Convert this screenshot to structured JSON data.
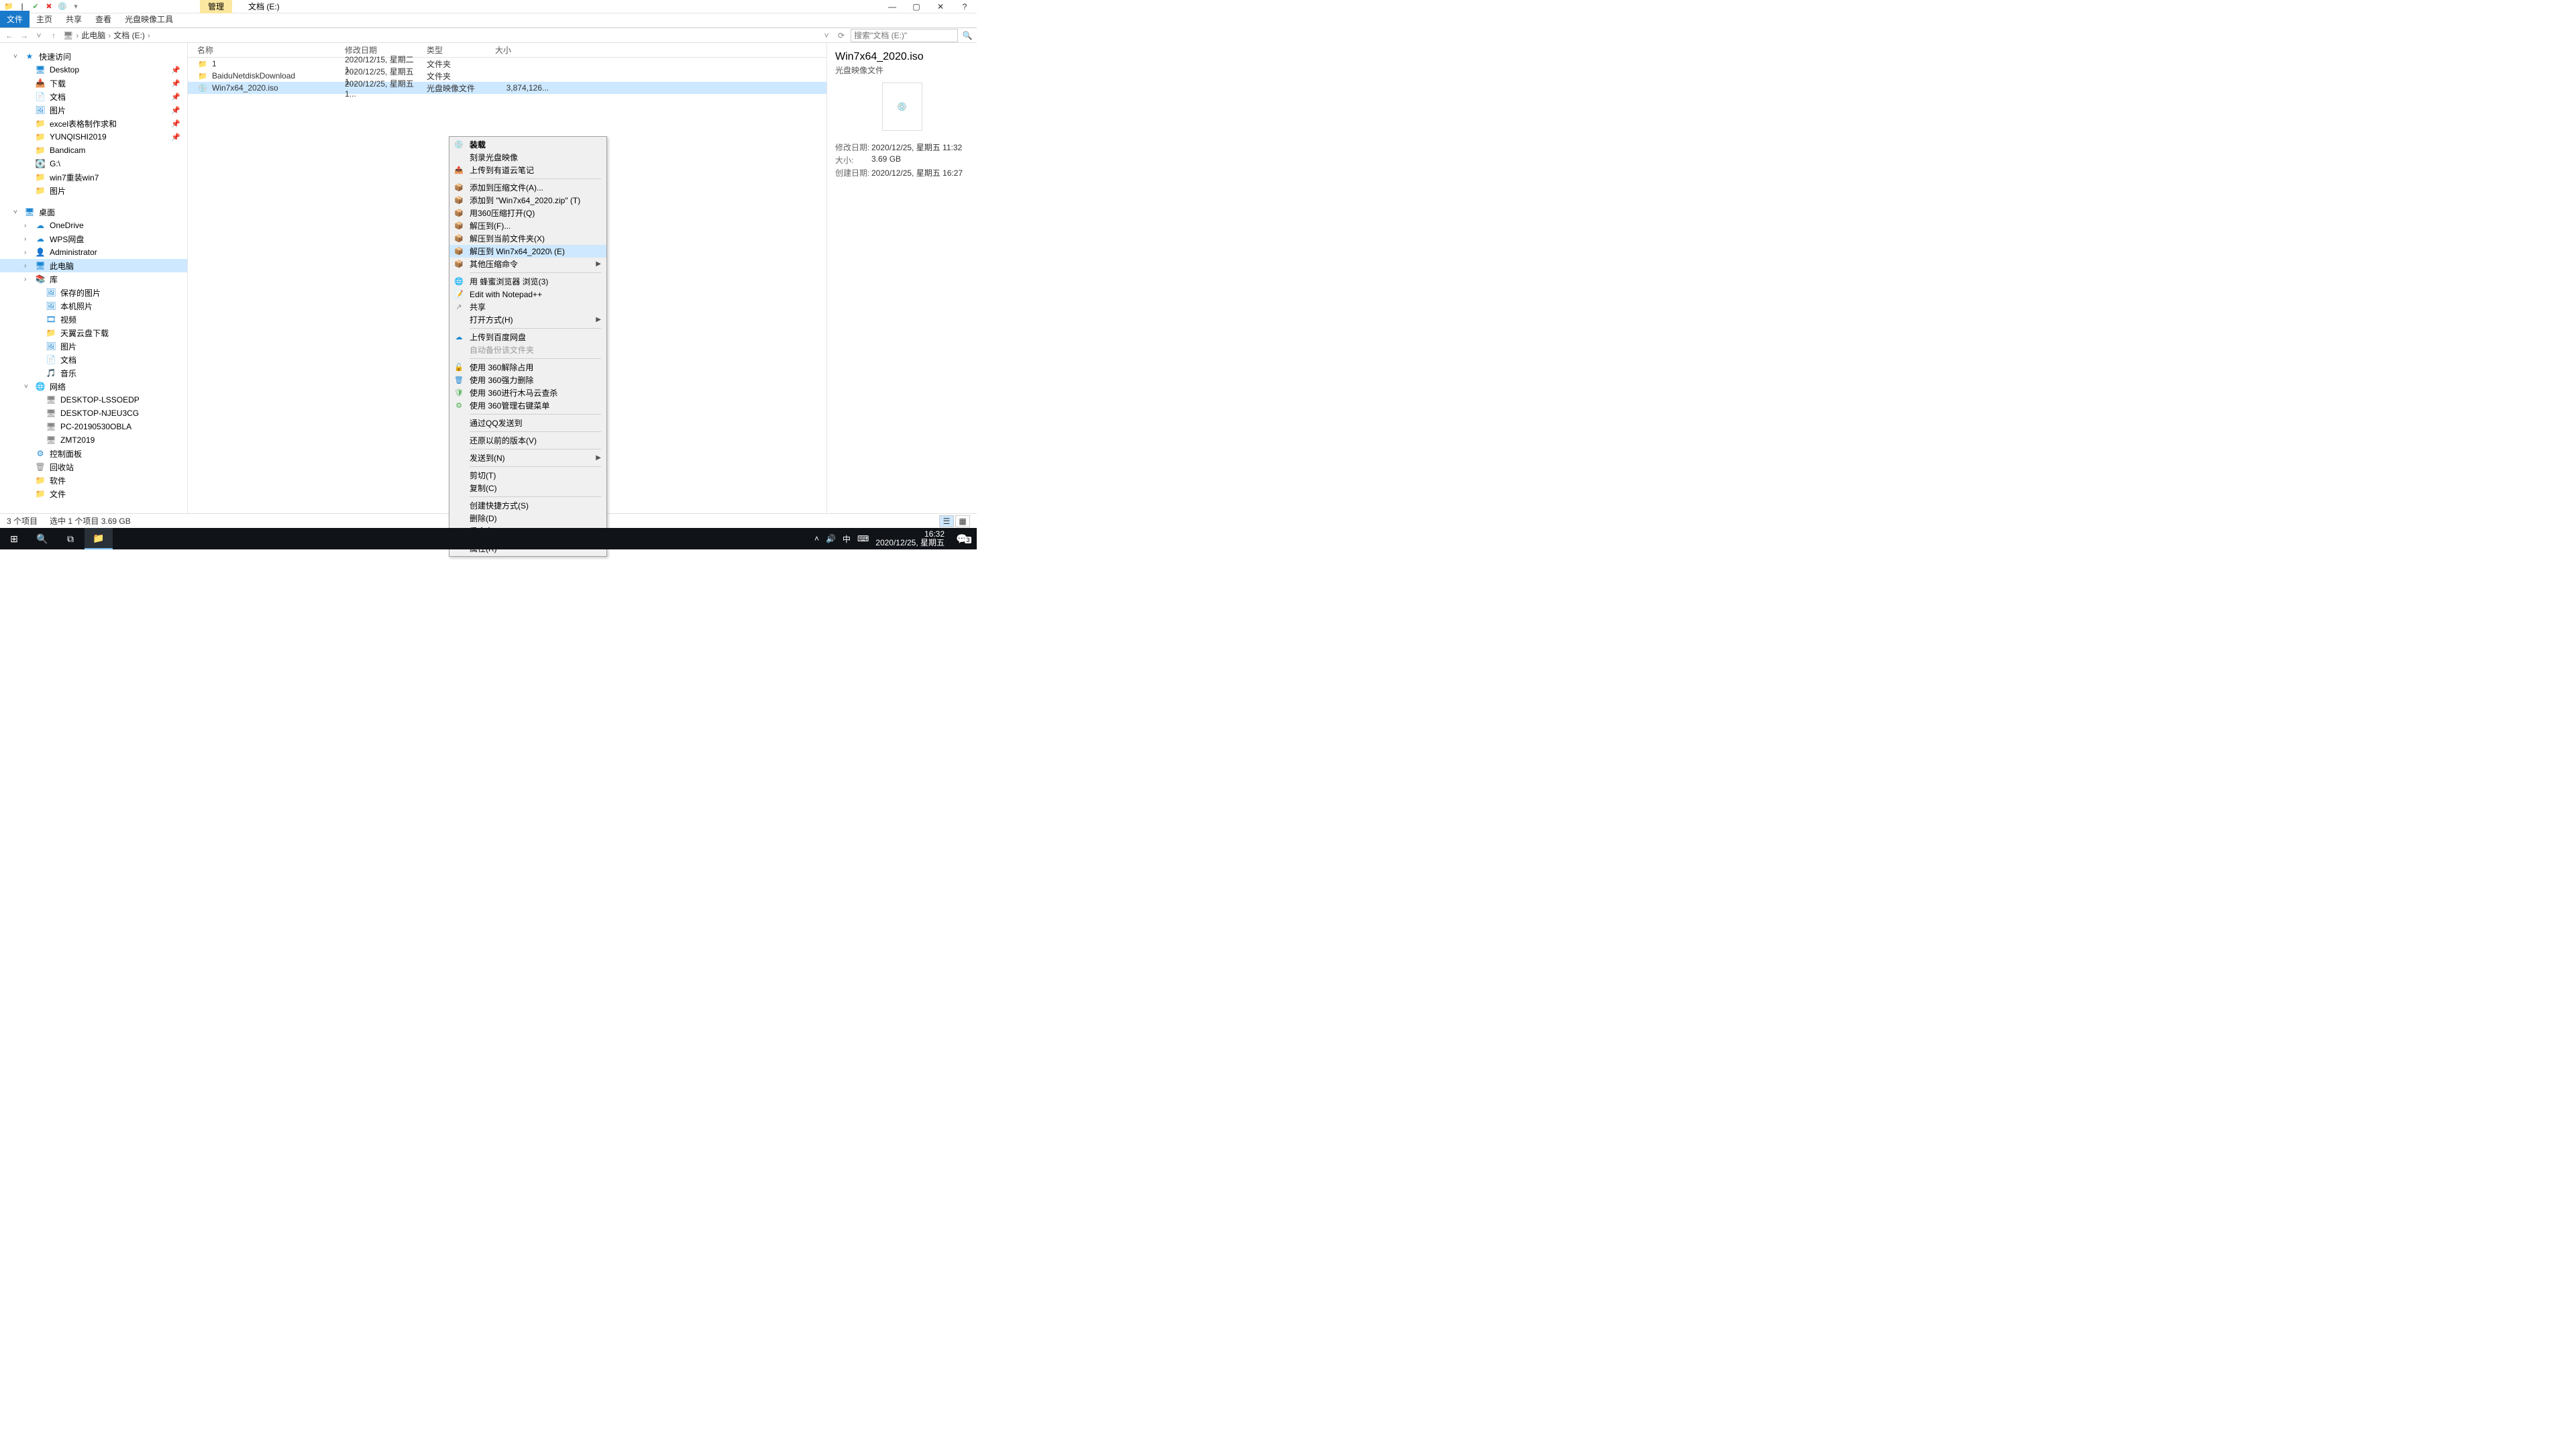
{
  "window": {
    "context_tab": "管理",
    "title": "文档 (E:)",
    "min": "—",
    "max": "▢",
    "close": "✕",
    "help": "?"
  },
  "ribbon": {
    "file": "文件",
    "home": "主页",
    "share": "共享",
    "view": "查看",
    "iso_tools": "光盘映像工具"
  },
  "address": {
    "back": "←",
    "forward": "→",
    "up": "↑",
    "root": "此电脑",
    "folder": "文档 (E:)",
    "sep": "›",
    "refresh": "⟳",
    "dropdown": "˅",
    "search_placeholder": "搜索\"文档 (E:)\"",
    "search_icon": "🔍"
  },
  "tree": {
    "quick": "快速访问",
    "quick_items": [
      {
        "label": "Desktop",
        "icon": "🖥",
        "pinned": true,
        "color": "color-blue"
      },
      {
        "label": "下载",
        "icon": "📥",
        "pinned": true,
        "color": "color-blue"
      },
      {
        "label": "文档",
        "icon": "📄",
        "pinned": true,
        "color": "color-blue"
      },
      {
        "label": "图片",
        "icon": "🖼",
        "pinned": true,
        "color": "color-blue"
      },
      {
        "label": "excel表格制作求和",
        "icon": "📁",
        "pinned": true,
        "color": "color-yellow"
      },
      {
        "label": "YUNQISHI2019",
        "icon": "📁",
        "pinned": true,
        "color": "color-yellow"
      },
      {
        "label": "Bandicam",
        "icon": "📁",
        "pinned": false,
        "color": "color-yellow"
      },
      {
        "label": "G:\\",
        "icon": "💽",
        "pinned": false,
        "color": "color-gray"
      },
      {
        "label": "win7重装win7",
        "icon": "📁",
        "pinned": false,
        "color": "color-yellow"
      },
      {
        "label": "图片",
        "icon": "📁",
        "pinned": false,
        "color": "color-yellow"
      }
    ],
    "desktop": "桌面",
    "desktop_items": [
      {
        "label": "OneDrive",
        "icon": "☁",
        "color": "color-blue"
      },
      {
        "label": "WPS网盘",
        "icon": "☁",
        "color": "color-blue"
      },
      {
        "label": "Administrator",
        "icon": "👤",
        "color": "color-teal"
      },
      {
        "label": "此电脑",
        "icon": "🖥",
        "color": "color-blue",
        "selected": true
      },
      {
        "label": "库",
        "icon": "📚",
        "color": "color-blue"
      }
    ],
    "lib_items": [
      {
        "label": "保存的图片",
        "icon": "🖼",
        "color": "color-blue"
      },
      {
        "label": "本机照片",
        "icon": "🖼",
        "color": "color-blue"
      },
      {
        "label": "视频",
        "icon": "🎞",
        "color": "color-blue"
      },
      {
        "label": "天翼云盘下载",
        "icon": "📁",
        "color": "color-yellow"
      },
      {
        "label": "图片",
        "icon": "🖼",
        "color": "color-blue"
      },
      {
        "label": "文档",
        "icon": "📄",
        "color": "color-blue"
      },
      {
        "label": "音乐",
        "icon": "🎵",
        "color": "color-blue"
      }
    ],
    "network": "网络",
    "network_items": [
      {
        "label": "DESKTOP-LSSOEDP",
        "icon": "🖥",
        "color": "color-gray"
      },
      {
        "label": "DESKTOP-NJEU3CG",
        "icon": "🖥",
        "color": "color-gray"
      },
      {
        "label": "PC-20190530OBLA",
        "icon": "🖥",
        "color": "color-gray"
      },
      {
        "label": "ZMT2019",
        "icon": "🖥",
        "color": "color-gray"
      }
    ],
    "bottom_items": [
      {
        "label": "控制面板",
        "icon": "⚙",
        "color": "color-blue"
      },
      {
        "label": "回收站",
        "icon": "🗑",
        "color": "color-gray"
      },
      {
        "label": "软件",
        "icon": "📁",
        "color": "color-yellow"
      },
      {
        "label": "文件",
        "icon": "📁",
        "color": "color-yellow"
      }
    ]
  },
  "list": {
    "headers": {
      "name": "名称",
      "date": "修改日期",
      "type": "类型",
      "size": "大小"
    },
    "rows": [
      {
        "name": "1",
        "date": "2020/12/15, 星期二 1...",
        "type": "文件夹",
        "size": "",
        "icon": "📁",
        "ico_class": "folder-ico"
      },
      {
        "name": "BaiduNetdiskDownload",
        "date": "2020/12/25, 星期五 1...",
        "type": "文件夹",
        "size": "",
        "icon": "📁",
        "ico_class": "folder-ico"
      },
      {
        "name": "Win7x64_2020.iso",
        "date": "2020/12/25, 星期五 1...",
        "type": "光盘映像文件",
        "size": "3,874,126...",
        "icon": "💿",
        "ico_class": "iso-ico",
        "selected": true
      }
    ]
  },
  "context": [
    {
      "type": "item",
      "label": "装载",
      "bold": true,
      "icon": "💿",
      "color": "color-gray"
    },
    {
      "type": "item",
      "label": "刻录光盘映像",
      "icon": ""
    },
    {
      "type": "item",
      "label": "上传到有道云笔记",
      "icon": "📤",
      "color": "color-blue"
    },
    {
      "type": "sep"
    },
    {
      "type": "item",
      "label": "添加到压缩文件(A)...",
      "icon": "📦",
      "color": "color-orange"
    },
    {
      "type": "item",
      "label": "添加到 \"Win7x64_2020.zip\" (T)",
      "icon": "📦",
      "color": "color-orange"
    },
    {
      "type": "item",
      "label": "用360压缩打开(Q)",
      "icon": "📦",
      "color": "color-orange"
    },
    {
      "type": "item",
      "label": "解压到(F)...",
      "icon": "📦",
      "color": "color-orange"
    },
    {
      "type": "item",
      "label": "解压到当前文件夹(X)",
      "icon": "📦",
      "color": "color-orange"
    },
    {
      "type": "item",
      "label": "解压到 Win7x64_2020\\ (E)",
      "icon": "📦",
      "color": "color-orange",
      "hover": true
    },
    {
      "type": "item",
      "label": "其他压缩命令",
      "icon": "📦",
      "color": "color-orange",
      "sub": true
    },
    {
      "type": "sep"
    },
    {
      "type": "item",
      "label": "用 蜂蜜浏览器 浏览(3)",
      "icon": "🌐",
      "color": "color-green"
    },
    {
      "type": "item",
      "label": "Edit with Notepad++",
      "icon": "📝",
      "color": "color-green"
    },
    {
      "type": "item",
      "label": "共享",
      "icon": "↗",
      "color": "color-gray"
    },
    {
      "type": "item",
      "label": "打开方式(H)",
      "icon": "",
      "sub": true
    },
    {
      "type": "sep"
    },
    {
      "type": "item",
      "label": "上传到百度网盘",
      "icon": "☁",
      "color": "color-blue"
    },
    {
      "type": "item",
      "label": "自动备份该文件夹",
      "icon": "",
      "disabled": true
    },
    {
      "type": "sep"
    },
    {
      "type": "item",
      "label": "使用 360解除占用",
      "icon": "🔓",
      "color": "color-orange"
    },
    {
      "type": "item",
      "label": "使用 360强力删除",
      "icon": "🗑",
      "color": "color-blue"
    },
    {
      "type": "item",
      "label": "使用 360进行木马云查杀",
      "icon": "🛡",
      "color": "color-green"
    },
    {
      "type": "item",
      "label": "使用 360管理右键菜单",
      "icon": "⚙",
      "color": "color-green"
    },
    {
      "type": "sep"
    },
    {
      "type": "item",
      "label": "通过QQ发送到",
      "icon": ""
    },
    {
      "type": "sep"
    },
    {
      "type": "item",
      "label": "还原以前的版本(V)",
      "icon": ""
    },
    {
      "type": "sep"
    },
    {
      "type": "item",
      "label": "发送到(N)",
      "icon": "",
      "sub": true
    },
    {
      "type": "sep"
    },
    {
      "type": "item",
      "label": "剪切(T)",
      "icon": ""
    },
    {
      "type": "item",
      "label": "复制(C)",
      "icon": ""
    },
    {
      "type": "sep"
    },
    {
      "type": "item",
      "label": "创建快捷方式(S)",
      "icon": ""
    },
    {
      "type": "item",
      "label": "删除(D)",
      "icon": ""
    },
    {
      "type": "item",
      "label": "重命名(M)",
      "icon": ""
    },
    {
      "type": "sep"
    },
    {
      "type": "item",
      "label": "属性(R)",
      "icon": ""
    }
  ],
  "details": {
    "title": "Win7x64_2020.iso",
    "type": "光盘映像文件",
    "rows": [
      {
        "label": "修改日期:",
        "val": "2020/12/25, 星期五 11:32"
      },
      {
        "label": "大小:",
        "val": "3.69 GB"
      },
      {
        "label": "创建日期:",
        "val": "2020/12/25, 星期五 16:27"
      }
    ]
  },
  "status": {
    "count": "3 个项目",
    "sel": "选中 1 个项目  3.69 GB"
  },
  "taskbar": {
    "ime": "中",
    "time": "16:32",
    "date": "2020/12/25, 星期五",
    "notif_count": "3"
  }
}
